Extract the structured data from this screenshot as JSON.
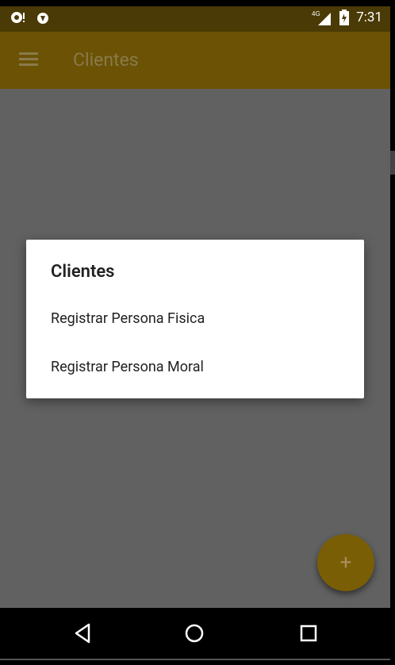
{
  "status_bar": {
    "time": "7:31",
    "network": "4G"
  },
  "app_bar": {
    "title": "Clientes"
  },
  "dialog": {
    "title": "Clientes",
    "items": [
      {
        "label": "Registrar Persona Fisica"
      },
      {
        "label": "Registrar Persona Moral"
      }
    ]
  },
  "fab": {
    "label": "+"
  },
  "nav": {
    "buttons": [
      "back-icon",
      "home-icon",
      "recents-icon"
    ]
  },
  "colors": {
    "accent": "#6b5205",
    "status": "#4a3a05",
    "scrim": "#616161"
  }
}
